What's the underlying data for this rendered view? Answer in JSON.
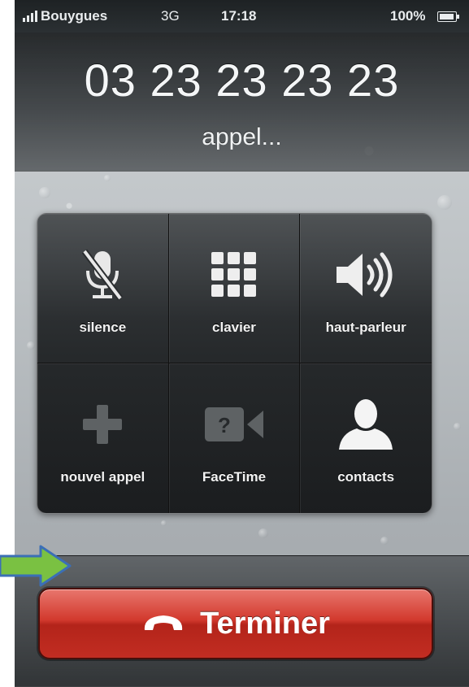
{
  "status_bar": {
    "carrier": "Bouygues",
    "network": "3G",
    "time": "17:18",
    "battery": "100%"
  },
  "call": {
    "number": "03 23 23 23 23",
    "status": "appel..."
  },
  "buttons": {
    "mute": "silence",
    "keypad": "clavier",
    "speaker": "haut-parleur",
    "add_call": "nouvel appel",
    "facetime": "FaceTime",
    "contacts": "contacts"
  },
  "end_call": {
    "label": "Terminer"
  },
  "colors": {
    "end_button": "#d2392d",
    "arrow": "#7ac142",
    "arrow_outline": "#3b6fb6"
  },
  "icons": [
    "signal-icon",
    "battery-icon",
    "mic-muted-icon",
    "keypad-icon",
    "speaker-icon",
    "plus-icon",
    "facetime-icon",
    "contact-icon",
    "phone-hangup-icon",
    "arrow-icon"
  ]
}
